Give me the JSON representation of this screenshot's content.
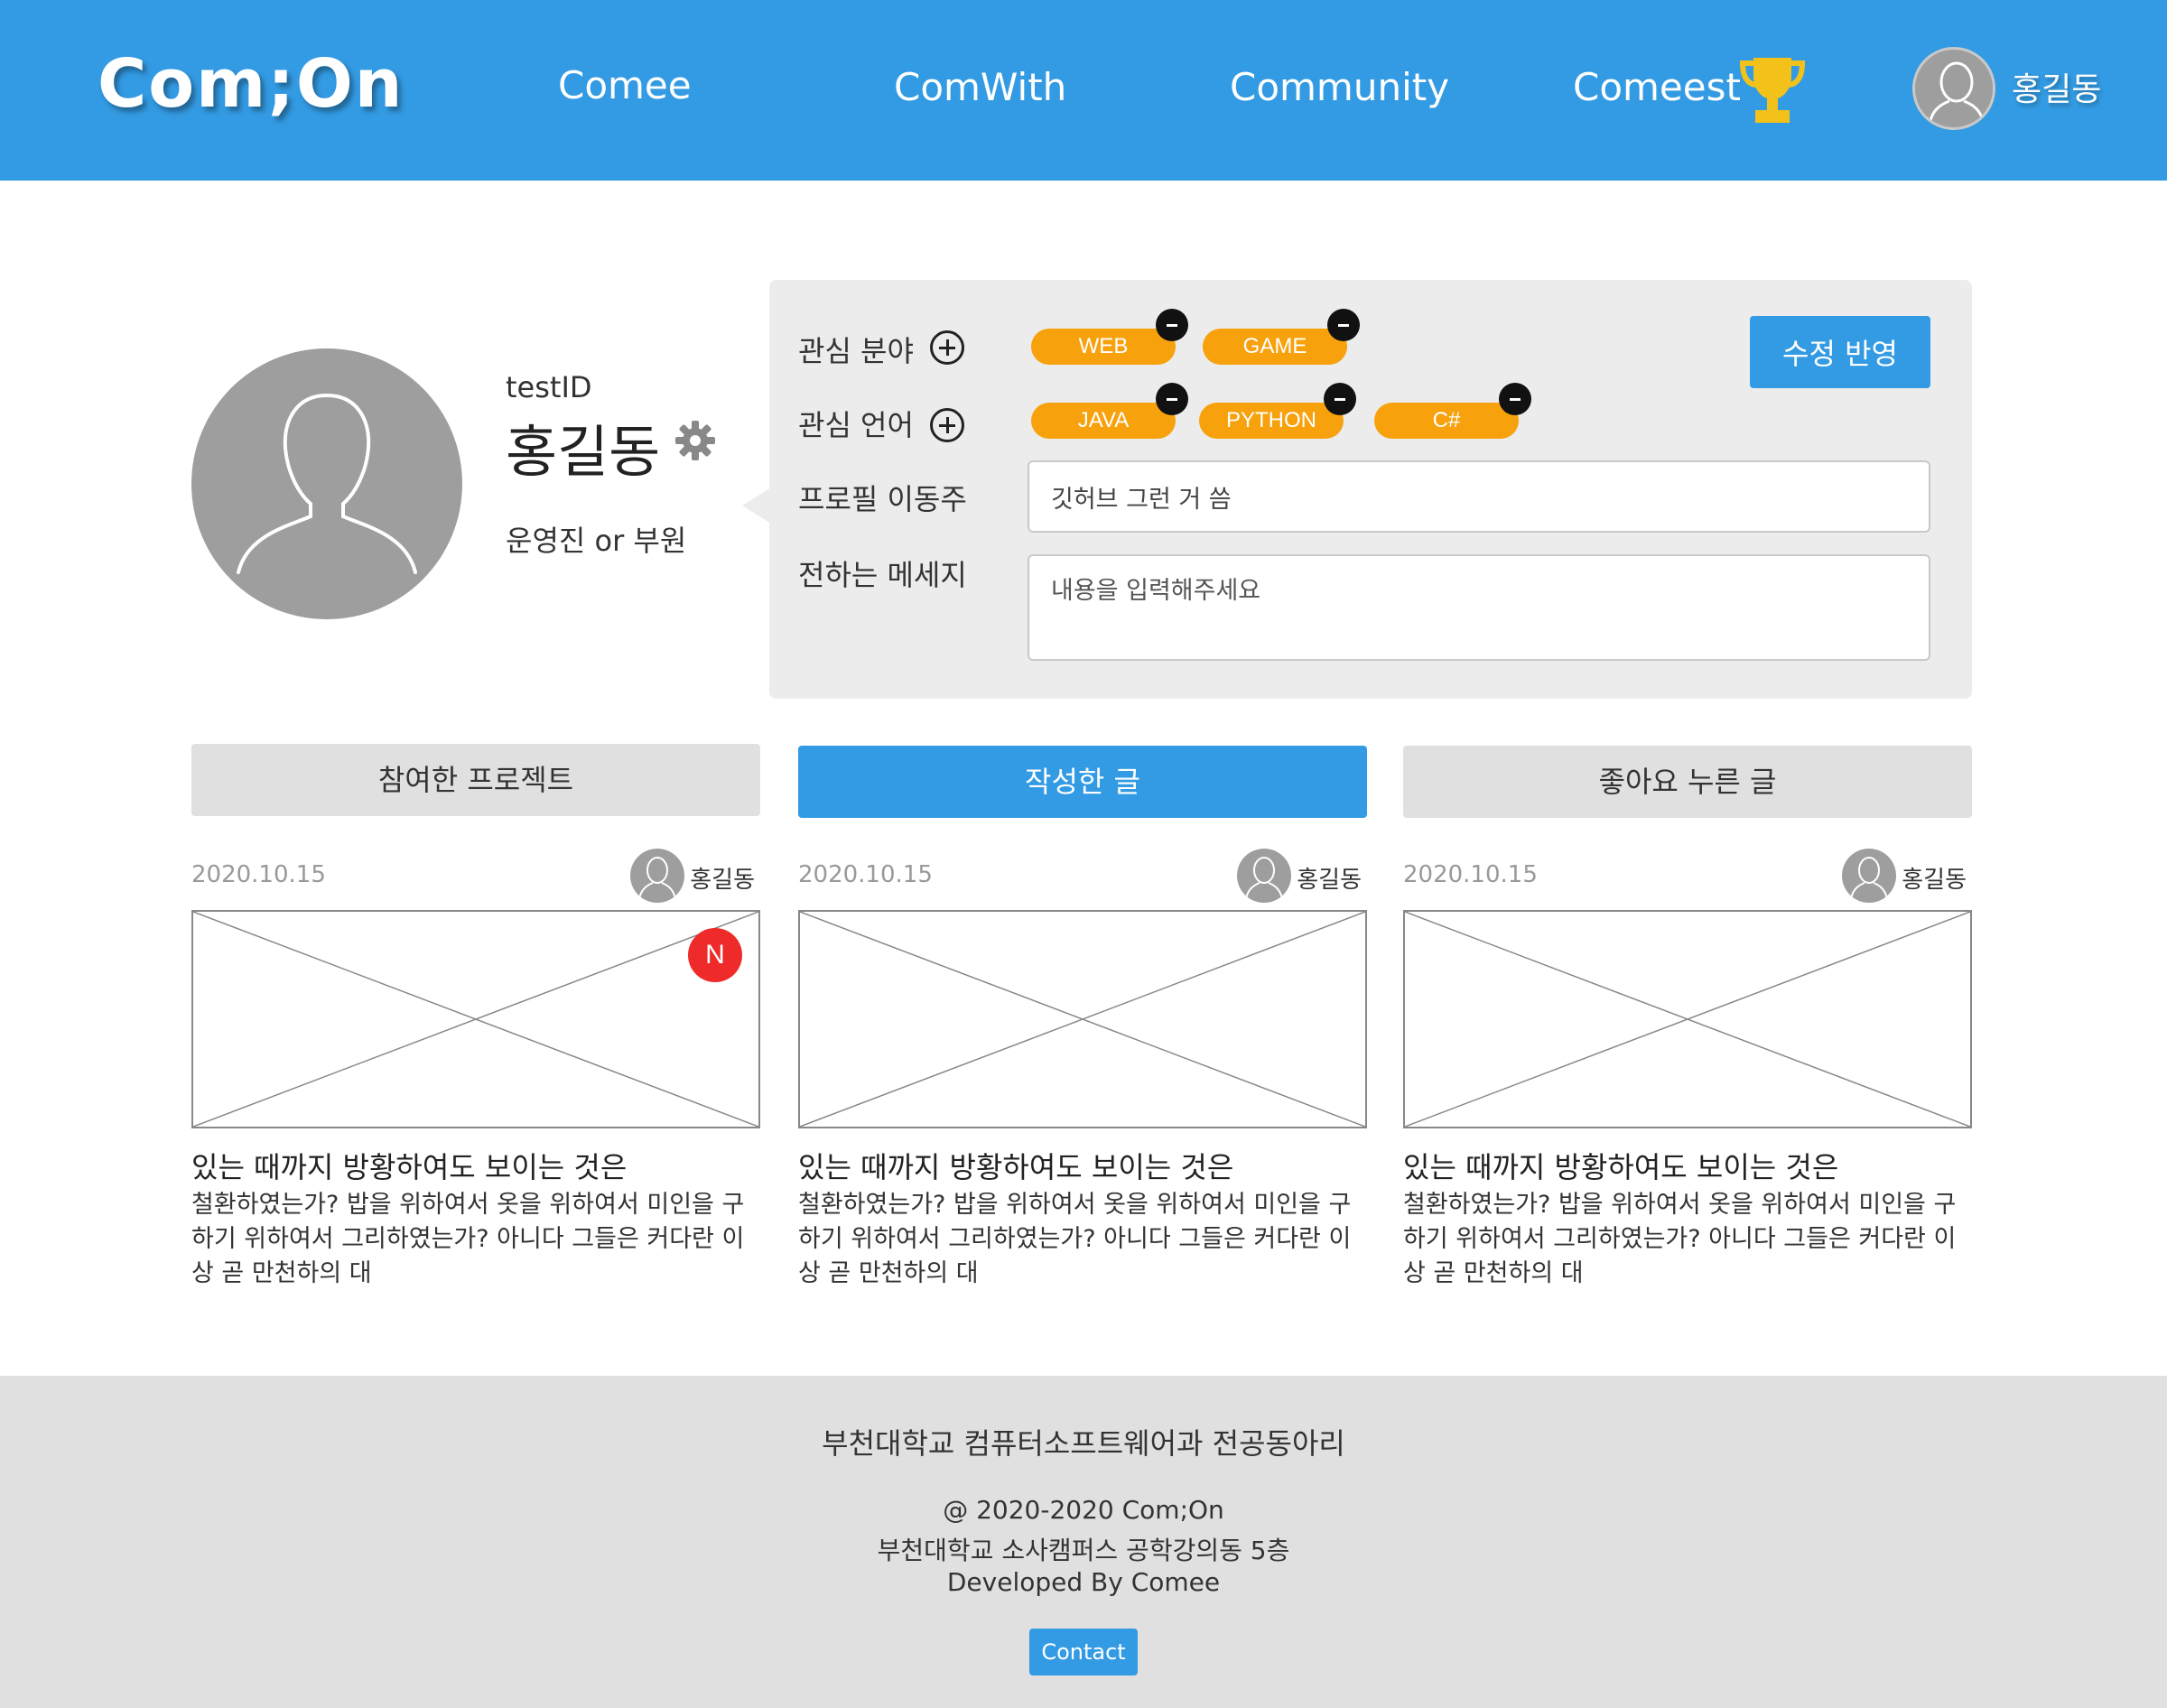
{
  "header": {
    "logo": "Com;On",
    "nav": [
      "Comee",
      "ComWith",
      "Community",
      "Comeest"
    ],
    "user_name": "홍길동",
    "trophy_icon": "trophy-icon",
    "bg_color": "#339be3"
  },
  "profile": {
    "id": "testID",
    "name": "홍길동",
    "role": "운영진 or 부원",
    "avatar_icon": "user-silhouette-icon",
    "settings_icon": "gear-icon"
  },
  "edit_panel": {
    "interest_field_label": "관심 분야",
    "interest_fields": [
      "WEB",
      "GAME"
    ],
    "interest_language_label": "관심 언어",
    "interest_languages": [
      "JAVA",
      "PYTHON",
      "C#"
    ],
    "profile_link_label": "프로필 이동주",
    "profile_link_value": "깃허브 그런 거 씀",
    "message_label": "전하는 메세지",
    "message_placeholder": "내용을 입력해주세요",
    "apply_button": "수정 반영",
    "tag_color": "#f7a10c"
  },
  "tabs": [
    {
      "label": "참여한 프로젝트",
      "active": false
    },
    {
      "label": "작성한 글",
      "active": true
    },
    {
      "label": "좋아요 누른 글",
      "active": false
    }
  ],
  "cards": [
    {
      "date": "2020.10.15",
      "author": "홍길동",
      "badge": "N",
      "title": "있는 때까지 방황하여도 보이는 것은",
      "body": "철환하였는가? 밥을 위하여서 옷을 위하여서 미인을 구하기 위하여서 그리하였는가? 아니다 그들은 커다란 이상 곧 만천하의 대"
    },
    {
      "date": "2020.10.15",
      "author": "홍길동",
      "title": "있는 때까지 방황하여도 보이는 것은",
      "body": "철환하였는가? 밥을 위하여서 옷을 위하여서 미인을 구하기 위하여서 그리하였는가? 아니다 그들은 커다란 이상 곧 만천하의 대"
    },
    {
      "date": "2020.10.15",
      "author": "홍길동",
      "title": "있는 때까지 방황하여도 보이는 것은",
      "body": "철환하였는가? 밥을 위하여서 옷을 위하여서 미인을 구하기 위하여서 그리하였는가? 아니다 그들은 커다란 이상 곧 만천하의 대"
    }
  ],
  "footer": {
    "title": "부천대학교 컴퓨터소프트웨어과 전공동아리",
    "copyright": "@ 2020-2020 Com;On",
    "address": "부천대학교 소사캠퍼스 공학강의동 5층",
    "developer": "Developed By Comee",
    "contact_button": "Contact"
  }
}
